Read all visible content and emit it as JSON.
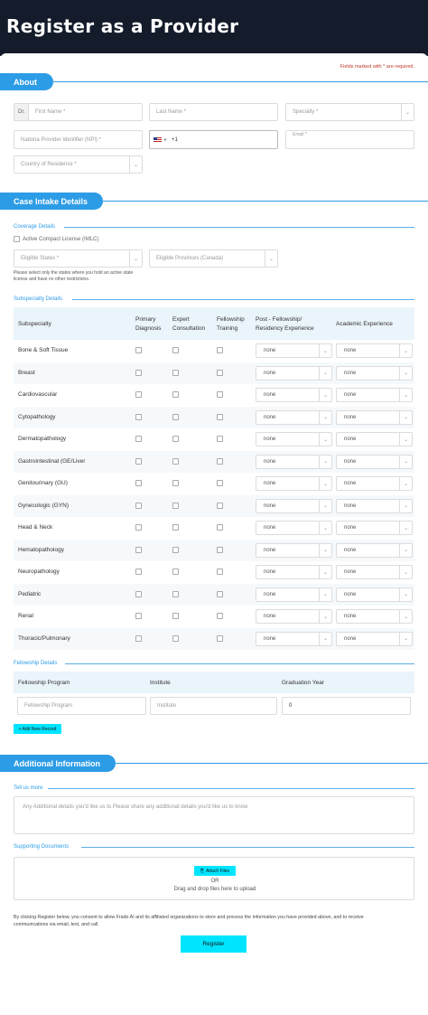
{
  "page": {
    "title": "Register as a Provider",
    "required_note": "Fields marked with * are required."
  },
  "about": {
    "heading": "About",
    "prefix": "Dr.",
    "first_name": "First Name *",
    "last_name": "Last Name *",
    "specialty": "Specialty *",
    "npi": "Nationa Provider Identifier (NPI) *",
    "phone_code": "+1",
    "email_label": "Email *",
    "country": "Country of Residence *"
  },
  "case": {
    "heading": "Case Intake Details",
    "coverage_heading": "Coverage Details",
    "imlc_label": "Active Compact License (IMLC)",
    "eligible_states": "Eligible States *",
    "eligible_provinces": "Eligible Provinces (Canada)",
    "states_note_1": "Please select only the states where you hold an active state",
    "states_note_2": "license and have no other restrictions.",
    "subspecialty_heading": "Subspecialty Details",
    "columns": {
      "subspecialty": "Subspecialty",
      "primary_1": "Primary",
      "primary_2": "Diagnosis",
      "expert_1": "Expert",
      "expert_2": "Consultation",
      "fellow_1": "Fellowship",
      "fellow_2": "Training",
      "post_1": "Post - Fellowship/",
      "post_2": "Residency Experience",
      "academic": "Academic Experience"
    },
    "rows": [
      {
        "name": "Bone & Soft Tissue",
        "post": "none",
        "academic": "none"
      },
      {
        "name": "Breast",
        "post": "none",
        "academic": "none"
      },
      {
        "name": "Cardiovascular",
        "post": "none",
        "academic": "none"
      },
      {
        "name": "Cytopathology",
        "post": "none",
        "academic": "none"
      },
      {
        "name": "Dermatopathology",
        "post": "none",
        "academic": "none"
      },
      {
        "name": "Gastrointestinal (GE/Liver",
        "post": "none",
        "academic": "none"
      },
      {
        "name": "Genitourinary (GU)",
        "post": "none",
        "academic": "none"
      },
      {
        "name": "Gynecologic (GYN)",
        "post": "none",
        "academic": "none"
      },
      {
        "name": "Head & Neck",
        "post": "none",
        "academic": "none"
      },
      {
        "name": "Hematopathology",
        "post": "none",
        "academic": "none"
      },
      {
        "name": "Neuropathology",
        "post": "none",
        "academic": "none"
      },
      {
        "name": "Pediatric",
        "post": "none",
        "academic": "none"
      },
      {
        "name": "Renal",
        "post": "none",
        "academic": "none"
      },
      {
        "name": "Thoracic/Pulmonary",
        "post": "none",
        "academic": "none"
      }
    ],
    "fellowship_heading": "Fellowship Details",
    "fellowship_columns": {
      "program": "Fellowship Program",
      "institute": "Institute",
      "year": "Graduation Year"
    },
    "fellowship_program_ph": "Fellowship Program",
    "institute_ph": "Institute",
    "graduation_year": "0",
    "add_record": "+ Add New Record"
  },
  "additional": {
    "heading": "Additional Information",
    "tell_heading": "Tell us more",
    "tell_placeholder": "Any Additional details you'd like us to Please share any additional details you'd like us to know",
    "docs_heading": "Supporting Documents",
    "attach": "Attach Files",
    "or": "OR",
    "drag": "Drag and drop files here to upload",
    "consent_1": "By clicking Register below, you consent to allow Frado AI and its affiliated organizations to store and process the information you have provided above, and to receive",
    "consent_2": "communications via email, text, and call.",
    "register": "Register"
  },
  "colors": {
    "header": "#141c2b",
    "accent": "#2d9ce6",
    "button": "#00e5ff"
  }
}
